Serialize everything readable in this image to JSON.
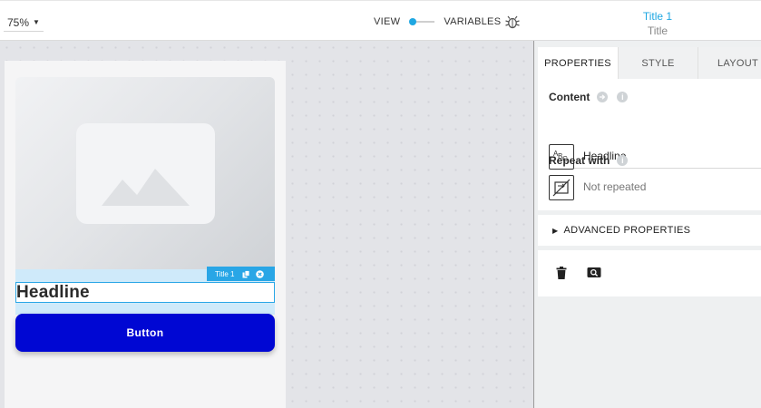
{
  "toolbar": {
    "zoom": "75%",
    "view_label": "VIEW",
    "variables_label": "VARIABLES",
    "page_title": "Title 1",
    "page_subtitle": "Title"
  },
  "canvas": {
    "selection_tag": "Title 1",
    "headline": "Headline",
    "button_label": "Button"
  },
  "panel": {
    "tabs": [
      {
        "label": "PROPERTIES"
      },
      {
        "label": "STYLE"
      },
      {
        "label": "LAYOUT"
      }
    ],
    "content_label": "Content",
    "content_value": "Headline",
    "repeat_label": "Repeat with",
    "repeat_value": "Not repeated",
    "advanced_label": "ADVANCED PROPERTIES"
  },
  "colors": {
    "accent": "#1fa7e2",
    "button": "#0007d3",
    "selection": "#29a6e6"
  },
  "icons": [
    "chevron-down-icon",
    "bug-icon",
    "copy-icon",
    "close-icon",
    "arrow-right-icon",
    "info-icon",
    "text-type-icon",
    "no-repeat-icon",
    "caret-right-icon",
    "trash-icon",
    "search-icon",
    "image-placeholder-icon"
  ]
}
